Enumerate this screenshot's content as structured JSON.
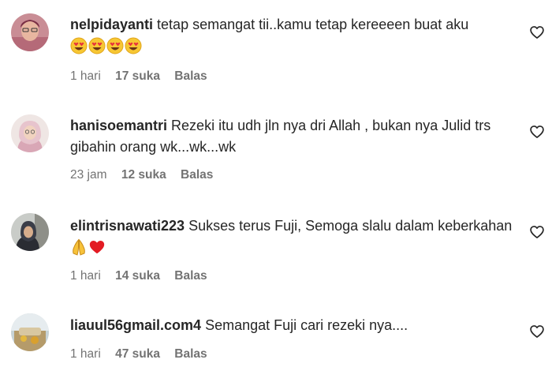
{
  "comments": [
    {
      "username": "nelpidayanti",
      "text": "tetap semangat tii..kamu tetap kereeeen buat aku",
      "emojis": [
        "heart-eyes-emoji",
        "heart-eyes-emoji",
        "heart-eyes-emoji",
        "heart-eyes-emoji"
      ],
      "time": "1 hari",
      "likes": "17 suka",
      "reply": "Balas"
    },
    {
      "username": "hanisoemantri",
      "text": "Rezeki itu udh jln nya dri Allah , bukan nya Julid trs gibahin orang wk...wk...wk",
      "emojis": [],
      "time": "23 jam",
      "likes": "12 suka",
      "reply": "Balas"
    },
    {
      "username": "elintrisnawati223",
      "text": "Sukses terus Fuji, Semoga slalu dalam keberkahan",
      "emojis": [
        "folded-hands-emoji",
        "red-heart-emoji"
      ],
      "time": "1 hari",
      "likes": "14 suka",
      "reply": "Balas"
    },
    {
      "username": "liauul56gmail.com4",
      "text": "Semangat Fuji cari rezeki nya....",
      "emojis": [],
      "time": "1 hari",
      "likes": "47 suka",
      "reply": "Balas"
    }
  ],
  "colors": {
    "text": "#262626",
    "secondary": "#737373",
    "background": "#ffffff"
  },
  "icons": {
    "like": "heart-outline-icon"
  }
}
